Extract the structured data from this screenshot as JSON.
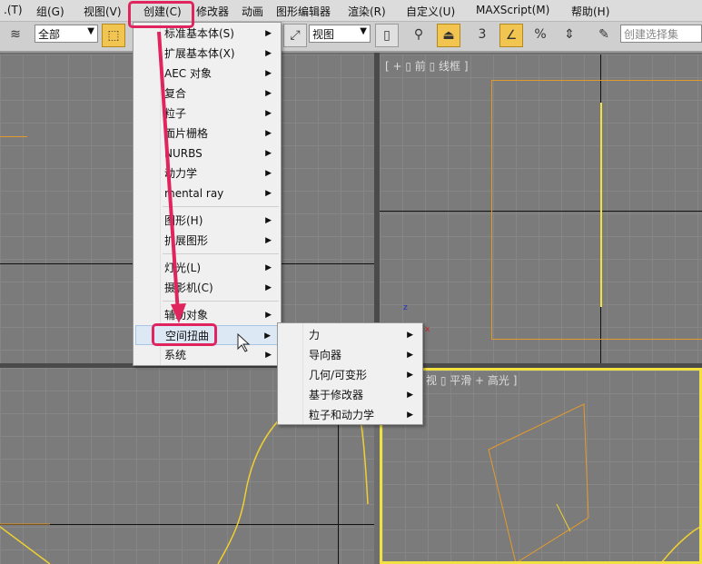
{
  "menubar": {
    "items": [
      ".(T)",
      "组(G)",
      "视图(V)",
      "创建(C)",
      "修改器",
      "动画",
      "图形编辑器",
      "渲染(R)",
      "自定义(U)",
      "MAXScript(M)",
      "帮助(H)"
    ]
  },
  "toolbar": {
    "selection_filter": "全部",
    "reference_coord": "视图",
    "named_selection_placeholder": "创建选择集",
    "snap_label": "3",
    "percent_label": "%"
  },
  "viewports": {
    "front_label": "[ + ▯ 前 ▯ 线框 ]",
    "perspective_label": "视 ▯ 平滑 + 高光 ]",
    "axis_z": "z",
    "axis_x": "x"
  },
  "create_menu": {
    "groups": [
      [
        "标准基本体(S)",
        "扩展基本体(X)",
        "AEC 对象",
        "复合",
        "粒子",
        "面片栅格",
        "NURBS",
        "动力学",
        "mental ray"
      ],
      [
        "图形(H)",
        "扩展图形"
      ],
      [
        "灯光(L)",
        "摄影机(C)"
      ],
      [
        "辅助对象",
        "空间扭曲",
        "系统"
      ]
    ],
    "highlighted": "空间扭曲"
  },
  "spacewarp_submenu": {
    "items": [
      "力",
      "导向器",
      "几何/可变形",
      "基于修改器",
      "粒子和动力学"
    ]
  },
  "colors": {
    "annotation": "#e0245e",
    "selection": "#f0c020",
    "object": "#e39a2c"
  }
}
